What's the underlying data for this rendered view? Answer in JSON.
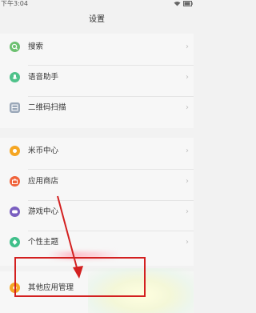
{
  "statusbar": {
    "time": "下午3:04",
    "icons": [
      "wifi-icon",
      "battery-icon"
    ]
  },
  "header": {
    "title": "设置"
  },
  "groups": [
    {
      "items": [
        {
          "label": "搜索",
          "icon": "search-icon",
          "color": "#6cc070"
        },
        {
          "label": "语音助手",
          "icon": "voice-assistant-icon",
          "color": "#4fc28a"
        },
        {
          "label": "二维码扫描",
          "icon": "qr-scan-icon",
          "color": "#9aa7b8"
        }
      ]
    },
    {
      "items": [
        {
          "label": "米币中心",
          "icon": "mi-coin-icon",
          "color": "#f5a623"
        },
        {
          "label": "应用商店",
          "icon": "app-store-icon",
          "color": "#f0643c"
        },
        {
          "label": "游戏中心",
          "icon": "game-center-icon",
          "color": "#7a5fc0"
        },
        {
          "label": "个性主题",
          "icon": "theme-icon",
          "color": "#3fbf8a"
        }
      ]
    },
    {
      "items": [
        {
          "label": "其他应用管理",
          "icon": "other-apps-icon",
          "color": "#f5a623"
        }
      ]
    }
  ],
  "chevron": "›",
  "annotation": {
    "box_color": "#d32020",
    "arrow_color": "#d32020"
  }
}
